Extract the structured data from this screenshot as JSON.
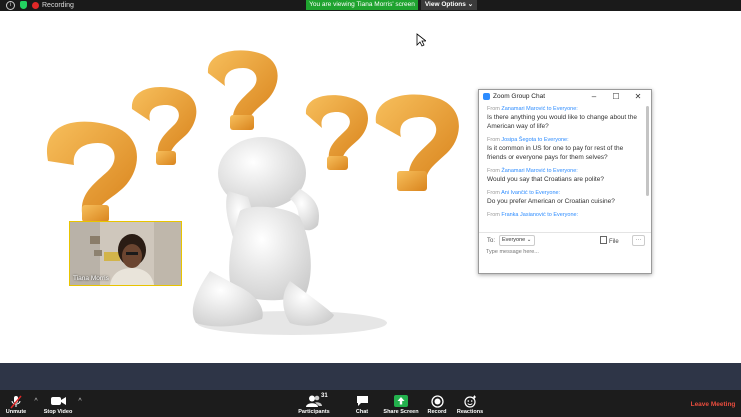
{
  "top_bar": {
    "recording_label": "Recording",
    "viewing_banner": "You are viewing Tiana Morris' screen",
    "view_options_label": "View Options",
    "view_options_caret": "⌄"
  },
  "speaker_video": {
    "name": "Tiana Morris"
  },
  "chat": {
    "title": "Zoom Group Chat",
    "minimize": "–",
    "maximize": "☐",
    "close": "✕",
    "messages": [
      {
        "from_prefix": "From",
        "from_name": "Žanamari Marović",
        "to_text": "to Everyone:",
        "text": "Is there anything you would like to change about the American way of life?"
      },
      {
        "from_prefix": "From",
        "from_name": "Josipa Šegota",
        "to_text": "to Everyone:",
        "text": "Is it common in US for one to pay for rest of the friends or everyone pays for them selves?"
      },
      {
        "from_prefix": "From",
        "from_name": "Žanamari Marović",
        "to_text": "to Everyone:",
        "text": "Would you say that Croatians are polite?"
      },
      {
        "from_prefix": "From",
        "from_name": "Ani Ivančić",
        "to_text": "to Everyone:",
        "text": "Do you prefer American or Croatian cuisine?"
      },
      {
        "from_prefix": "From",
        "from_name": "Franka Jasianović",
        "to_text": "to Everyone:",
        "text": ""
      }
    ],
    "to_label": "To:",
    "to_value": "Everyone ⌄",
    "file_label": "File",
    "more_label": "···",
    "input_placeholder": "Type message here..."
  },
  "toolbar": {
    "unmute": "Unmute",
    "stop_video": "Stop Video",
    "participants": "Participants",
    "participants_count": "31",
    "chat": "Chat",
    "share_screen": "Share Screen",
    "record": "Record",
    "reactions": "Reactions",
    "caret": "^",
    "leave_meeting": "Leave Meeting"
  },
  "colors": {
    "banner_green": "#1fa32f",
    "accent_blue": "#2d8cff",
    "leave_red": "#e84c3d",
    "question_orange": "#f0a23a"
  },
  "icons": [
    "info-icon",
    "shield-icon",
    "recording-dot-icon",
    "cursor-icon",
    "zoom-logo-icon",
    "file-icon",
    "microphone-muted-icon",
    "video-camera-icon",
    "participants-icon",
    "chat-bubble-icon",
    "share-screen-icon",
    "record-icon",
    "reactions-icon"
  ]
}
